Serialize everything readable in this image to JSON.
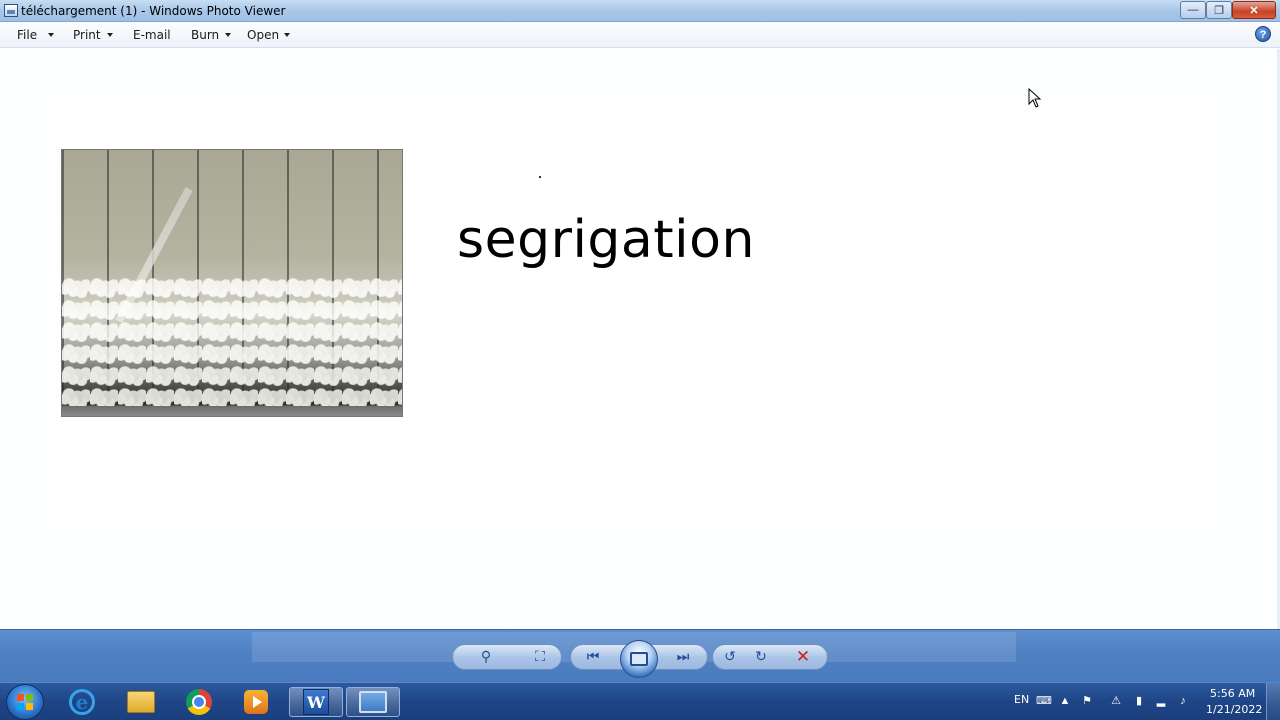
{
  "window": {
    "title": "téléchargement (1) - Windows Photo Viewer",
    "minimize": "—",
    "maximize": "❐",
    "close": "✕"
  },
  "menu": {
    "file": "File",
    "print": "Print",
    "email": "E-mail",
    "burn": "Burn",
    "open": "Open",
    "help": "?"
  },
  "slide": {
    "text": "segrigation"
  },
  "controls": {
    "zoom": "⚲",
    "actual_size": "⛶",
    "previous": "⏮",
    "next": "⏭",
    "rotate_ccw": "↺",
    "rotate_cw": "↻",
    "delete": "✕"
  },
  "taskbar": {
    "language": "EN",
    "time": "5:56 AM",
    "date": "1/21/2022",
    "word_label": "W"
  }
}
